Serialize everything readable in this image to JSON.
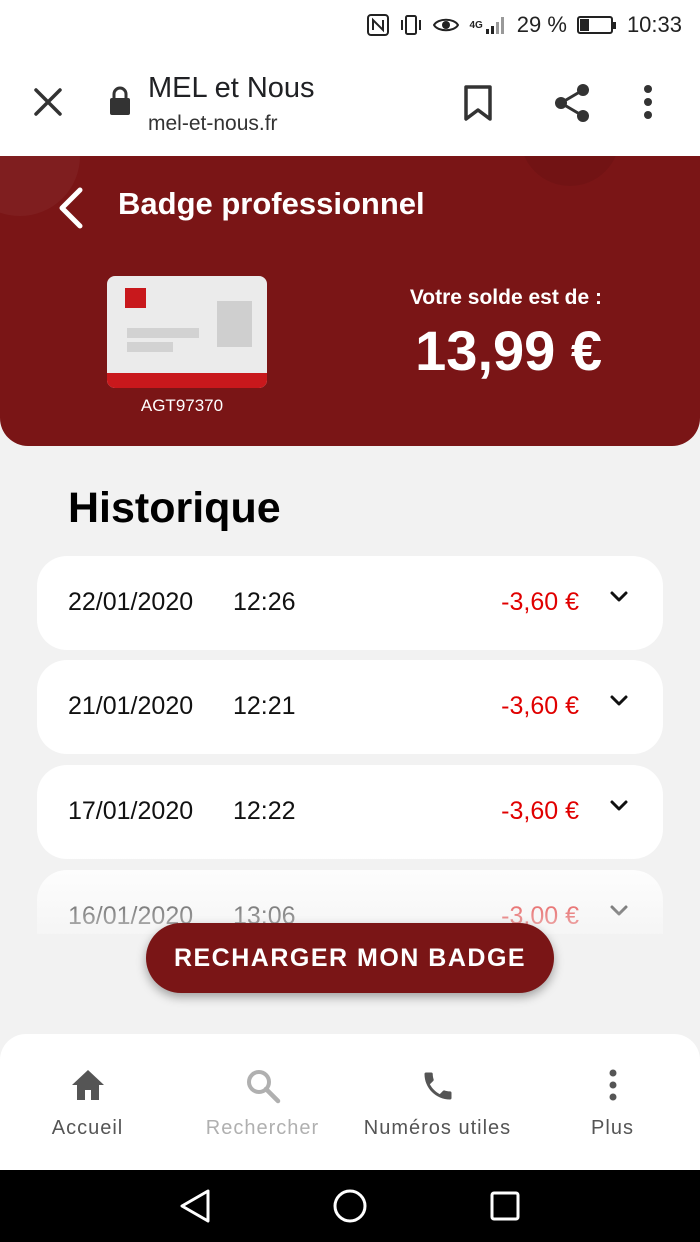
{
  "status_bar": {
    "battery": "29 %",
    "battery_level": 0.29,
    "time": "10:33",
    "network": "4G"
  },
  "browser": {
    "title": "MEL et Nous",
    "url": "mel-et-nous.fr"
  },
  "header": {
    "title": "Badge professionnel",
    "card_id": "AGT97370",
    "balance_label": "Votre solde est de :",
    "balance_value": "13,99 €"
  },
  "history": {
    "title": "Historique",
    "items": [
      {
        "date": "22/01/2020",
        "time": "12:26",
        "amount": "-3,60 €"
      },
      {
        "date": "21/01/2020",
        "time": "12:21",
        "amount": "-3,60 €"
      },
      {
        "date": "17/01/2020",
        "time": "12:22",
        "amount": "-3,60 €"
      },
      {
        "date": "16/01/2020",
        "time": "13:06",
        "amount": "-3,00 €"
      }
    ]
  },
  "recharge_button": "RECHARGER MON BADGE",
  "bottom_nav": [
    {
      "label": "Accueil",
      "icon": "home-icon"
    },
    {
      "label": "Rechercher",
      "icon": "search-icon"
    },
    {
      "label": "Numéros utiles",
      "icon": "phone-icon"
    },
    {
      "label": "Plus",
      "icon": "more-vertical-icon"
    }
  ],
  "colors": {
    "brand": "#7a1516",
    "negative": "#e00000",
    "card_red": "#c8181c"
  }
}
